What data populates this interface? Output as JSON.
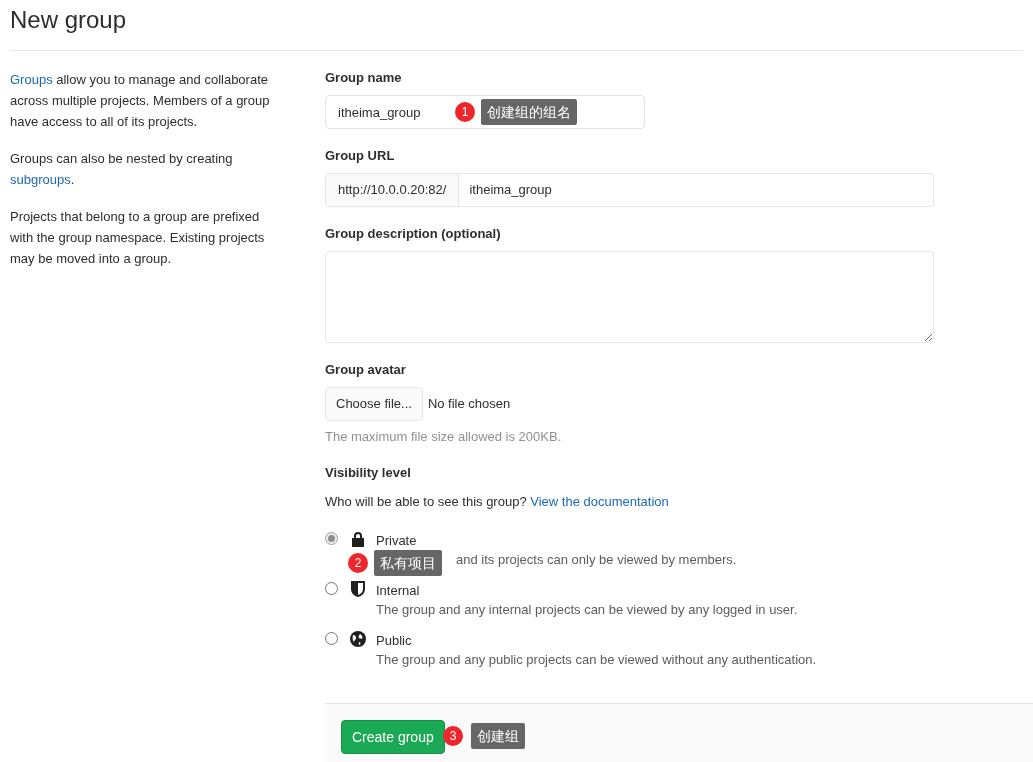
{
  "title": "New group",
  "intro": [
    {
      "parts": [
        {
          "kind": "link",
          "text": "Groups"
        },
        {
          "kind": "text",
          "text": " allow you to manage and collaborate across multiple projects. Members of a group have access to all of its projects."
        }
      ]
    },
    {
      "parts": [
        {
          "kind": "text",
          "text": "Groups can also be nested by creating "
        },
        {
          "kind": "link",
          "text": "subgroups"
        },
        {
          "kind": "text",
          "text": "."
        }
      ]
    },
    {
      "parts": [
        {
          "kind": "text",
          "text": "Projects that belong to a group are prefixed with the group namespace. Existing projects may be moved into a group."
        }
      ]
    }
  ],
  "group_name": {
    "label": "Group name",
    "value": "itheima_group",
    "annotation": {
      "number": "1",
      "text": "创建组的组名"
    }
  },
  "group_url": {
    "label": "Group URL",
    "prefix": "http://10.0.0.20:82/",
    "value": "itheima_group"
  },
  "group_description": {
    "label": "Group description (optional)"
  },
  "group_avatar": {
    "label": "Group avatar",
    "button": "Choose file...",
    "file_status": "No file chosen",
    "help": "The maximum file size allowed is 200KB."
  },
  "visibility": {
    "label": "Visibility level",
    "question": "Who will be able to see this group?",
    "link": "View the documentation",
    "options": [
      {
        "kind": "private",
        "label": "Private",
        "description": "and its projects can only be viewed by members.",
        "selected": true,
        "disabled": true,
        "annotation": {
          "number": "2",
          "text": "私有项目"
        }
      },
      {
        "kind": "internal",
        "label": "Internal",
        "description": "The group and any internal projects can be viewed by any logged in user.",
        "selected": false,
        "disabled": false
      },
      {
        "kind": "public",
        "label": "Public",
        "description": "The group and any public projects can be viewed without any authentication.",
        "selected": false,
        "disabled": false
      }
    ]
  },
  "submit": {
    "label": "Create group",
    "annotation": {
      "number": "3",
      "text": "创建组"
    }
  }
}
